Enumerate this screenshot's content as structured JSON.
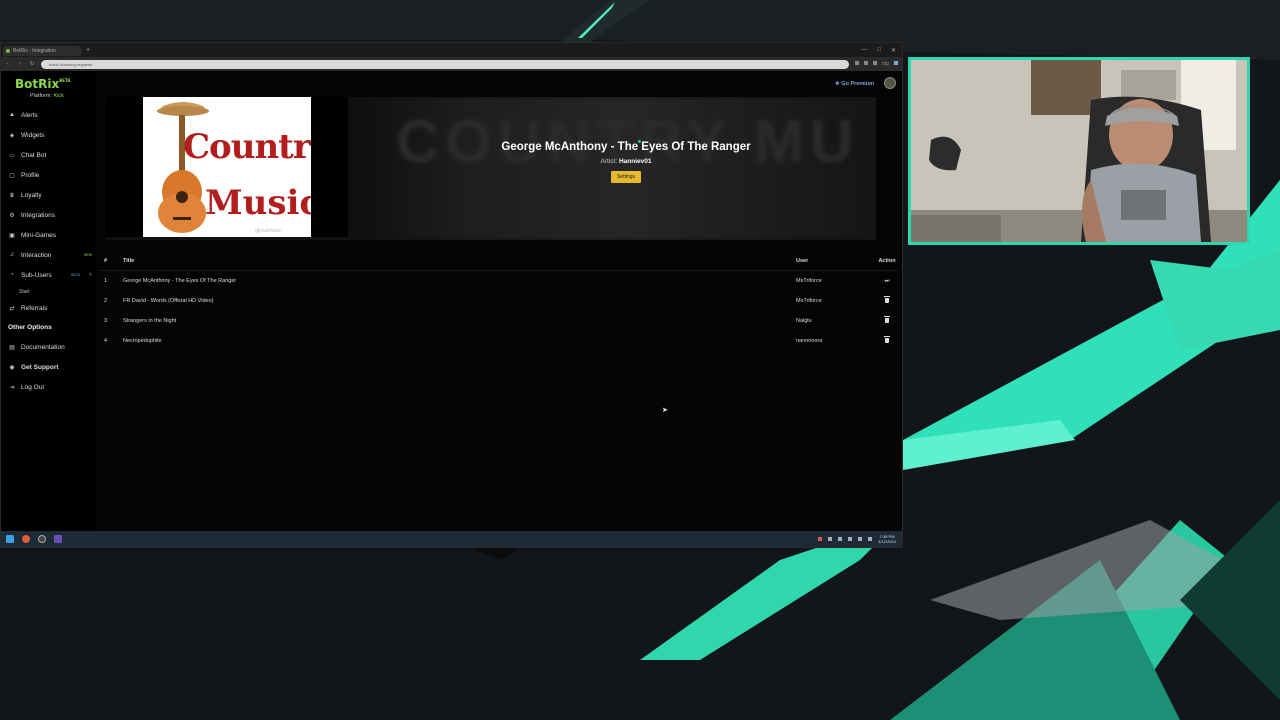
{
  "browser": {
    "tab_title": "BotRix - Integration",
    "url": "botrix.live/song-requests",
    "ext_label": "rdp"
  },
  "brand": {
    "name": "BotRix",
    "tag": "BETA"
  },
  "platform": {
    "label": "Platform:",
    "value": "Kick"
  },
  "sidebar": {
    "items": [
      {
        "label": "Alerts",
        "icon": "triangle-icon"
      },
      {
        "label": "Widgets",
        "icon": "layers-icon"
      },
      {
        "label": "Chat Bot",
        "icon": "chat-icon"
      },
      {
        "label": "Profile",
        "icon": "user-icon"
      },
      {
        "label": "Loyalty",
        "icon": "trophy-icon"
      },
      {
        "label": "Integrations",
        "icon": "gear-icon"
      },
      {
        "label": "Mini-Games",
        "icon": "gamepad-icon"
      },
      {
        "label": "Interaction",
        "icon": "music-icon",
        "badge": "NEW"
      },
      {
        "label": "Sub-Users",
        "icon": "users-icon",
        "badge": "BETA"
      },
      {
        "label": "Referrals",
        "icon": "share-icon"
      }
    ],
    "sub_item": "Start",
    "other_heading": "Other Options",
    "other_items": [
      {
        "label": "Documentation",
        "icon": "book-icon"
      },
      {
        "label": "Get Support",
        "icon": "support-icon"
      },
      {
        "label": "Log Out",
        "icon": "logout-icon"
      }
    ]
  },
  "header": {
    "premium_label": "Go Premium"
  },
  "now_playing": {
    "cover_text_1": "Country",
    "cover_text_2": "Music",
    "cover_watermark": "gfycatmusic",
    "title": "George McAnthony - The Eyes Of The Ranger",
    "artist_label": "Artist:",
    "artist": "Hanniev01",
    "settings_label": "Settings"
  },
  "queue": {
    "headers": {
      "num": "#",
      "title": "Title",
      "user": "User",
      "action": "Action"
    },
    "rows": [
      {
        "num": "1",
        "title": "George McAnthony - The Eyes Of The Ranger",
        "user": "MsTriforce",
        "action": "play"
      },
      {
        "num": "2",
        "title": "FR David - Words (Official HD Video)",
        "user": "MsTriforce",
        "action": "delete"
      },
      {
        "num": "3",
        "title": "Strangers in the Night",
        "user": "Nalglu",
        "action": "delete"
      },
      {
        "num": "4",
        "title": "Necropedophile",
        "user": "nanonoora",
        "action": "delete"
      }
    ]
  },
  "taskbar": {
    "time": "7:38 PM",
    "date": "4/12/2024"
  },
  "colors": {
    "accent": "#8bd94a",
    "webcam_border": "#2fd7ae",
    "settings_button": "#e6b92e"
  }
}
